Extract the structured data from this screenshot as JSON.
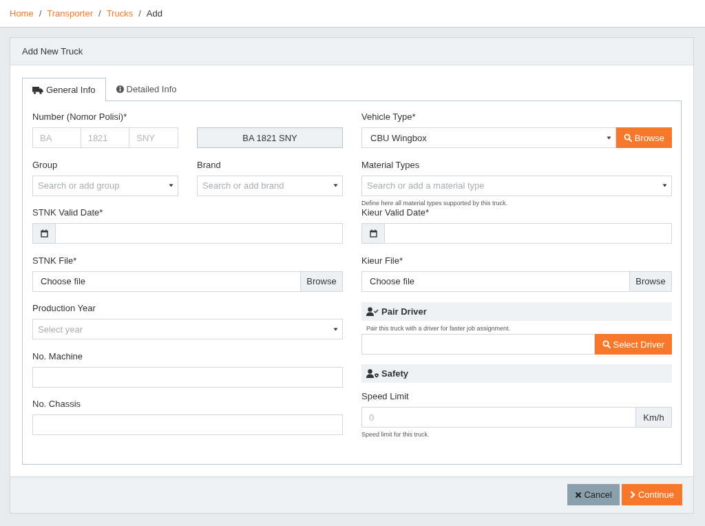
{
  "breadcrumb": {
    "separators": [
      "/",
      "/",
      "/"
    ],
    "items": [
      {
        "label": "Home",
        "link": true
      },
      {
        "label": "Transporter",
        "link": true
      },
      {
        "label": "Trucks",
        "link": true
      },
      {
        "label": "Add",
        "link": false
      }
    ]
  },
  "card": {
    "title": "Add New Truck"
  },
  "tabs": [
    {
      "label": "General Info",
      "selected": true
    },
    {
      "label": "Detailed Info",
      "selected": false
    }
  ],
  "left_fields": [
    {
      "kind": "plate",
      "label": "Number (Nomor Polisi)*",
      "parts": [
        {
          "placeholder": "BA"
        },
        {
          "placeholder": "1821"
        },
        {
          "placeholder": "SNY"
        }
      ],
      "display": "BA 1821 SNY"
    },
    {
      "kind": "select_pair",
      "items": [
        {
          "label": "Group",
          "placeholder": "Search or add group"
        },
        {
          "label": "Brand",
          "placeholder": "Search or add brand"
        }
      ]
    },
    {
      "kind": "date",
      "label": "STNK Valid Date*"
    },
    {
      "kind": "file",
      "label": "STNK File*",
      "value": "Choose file",
      "button": "Browse"
    },
    {
      "kind": "select",
      "label": "Production Year",
      "placeholder": "Select year"
    },
    {
      "kind": "text",
      "label": "No. Machine"
    },
    {
      "kind": "text",
      "label": "No. Chassis"
    }
  ],
  "right_fields": [
    {
      "kind": "select_button",
      "label": "Vehicle Type*",
      "value": "CBU Wingbox",
      "button": "Browse"
    },
    {
      "kind": "select",
      "label": "Material Types",
      "placeholder": "Search or add a material type",
      "help": "Define here all material types supported by this truck."
    },
    {
      "kind": "date",
      "label": "Kieur Valid Date*"
    },
    {
      "kind": "file",
      "label": "Kieur File*",
      "value": "Choose file",
      "button": "Browse"
    },
    {
      "kind": "pair",
      "title": "Pair Driver",
      "help": "Pair this truck with a driver for faster job assignment.",
      "button": "Select Driver"
    },
    {
      "kind": "speed",
      "title": "Safety",
      "label": "Speed Limit",
      "placeholder": "0",
      "unit": "Km/h",
      "help": "Speed limit for this truck."
    }
  ],
  "footer": {
    "buttons": [
      {
        "kind": "cancel",
        "label": "Cancel"
      },
      {
        "kind": "continue",
        "label": "Continue"
      }
    ]
  }
}
